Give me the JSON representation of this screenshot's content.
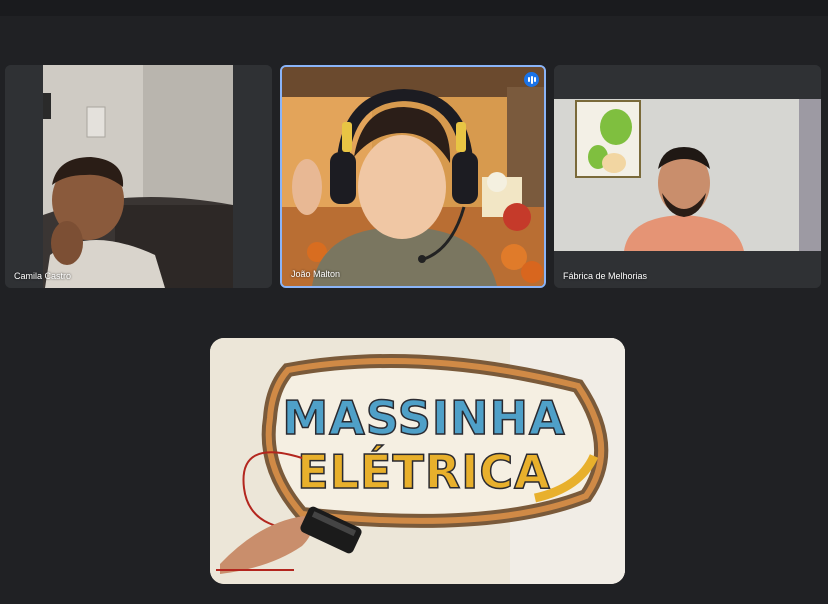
{
  "participants": [
    {
      "name": "Camila Castro",
      "speaking": false
    },
    {
      "name": "João Malton",
      "speaking": true
    },
    {
      "name": "Fábrica de Melhorias",
      "speaking": false
    }
  ],
  "presentation": {
    "logo_line1": "MASSINHA",
    "logo_line2": "ELÉTRICA"
  },
  "colors": {
    "background": "#202124",
    "active_border": "#8ab4f8",
    "speaking_badge": "#1a73e8"
  },
  "icons": [
    "speaking-indicator-icon",
    "headphones-icon",
    "microphone-icon",
    "battery-icon"
  ]
}
